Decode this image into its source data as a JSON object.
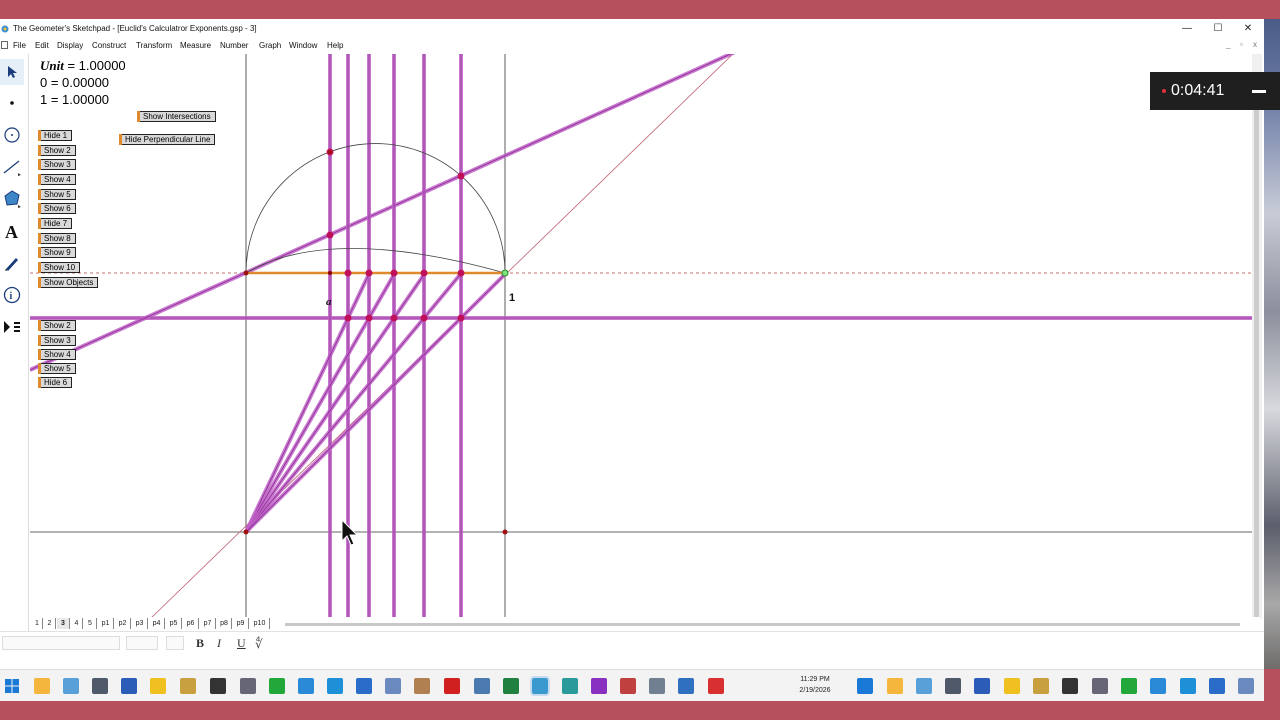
{
  "window": {
    "title": "The Geometer's Sketchpad - [Euclid's Calculatror Exponents.gsp - 3]",
    "minimize": "—",
    "maximize": "☐",
    "close": "✕"
  },
  "menu": [
    "File",
    "Edit",
    "Display",
    "Construct",
    "Transform",
    "Measure",
    "Number",
    "Graph",
    "Window",
    "Help"
  ],
  "tools": [
    "arrow-select-tool",
    "point-tool",
    "compass-tool",
    "straightedge-tool",
    "polygon-tool",
    "text-tool",
    "marker-tool",
    "information-tool",
    "custom-tool"
  ],
  "measurements": {
    "unit_label": "Unit",
    "unit_value": " = 1.00000",
    "zero": "0 = 0.00000",
    "one": "1 = 1.00000"
  },
  "buttons_top": [
    "Hide 1",
    "Show 2",
    "Show 3",
    "Show 4",
    "Show 5",
    "Show 6",
    "Hide 7",
    "Show 8",
    "Show 9",
    "Show 10",
    "Show Objects"
  ],
  "buttons_right": {
    "intersections": "Show Intersections",
    "perpendicular": "Hide Perpendicular Line"
  },
  "buttons_bottom": [
    "Show 2",
    "Show 3",
    "Show 4",
    "Show 5",
    "Hide 6"
  ],
  "labels": {
    "a": "a",
    "one": "1"
  },
  "page_tabs": [
    "1",
    "2",
    "3",
    "4",
    "5",
    "p1",
    "p2",
    "p3",
    "p4",
    "p5",
    "p6",
    "p7",
    "p8",
    "p9",
    "p10"
  ],
  "text_format": {
    "bold": "B",
    "italic": "I",
    "underline": "U"
  },
  "recorder": {
    "time": "0:04:41"
  },
  "clock": {
    "time": "11:29 PM",
    "date": "2/19/2026"
  },
  "colors": {
    "magenta_line": "#c060c8",
    "point": "#c0105a",
    "orange_segment": "#e08a2e",
    "button_face": "#d9d9d9",
    "desktop": "#b5505c"
  }
}
